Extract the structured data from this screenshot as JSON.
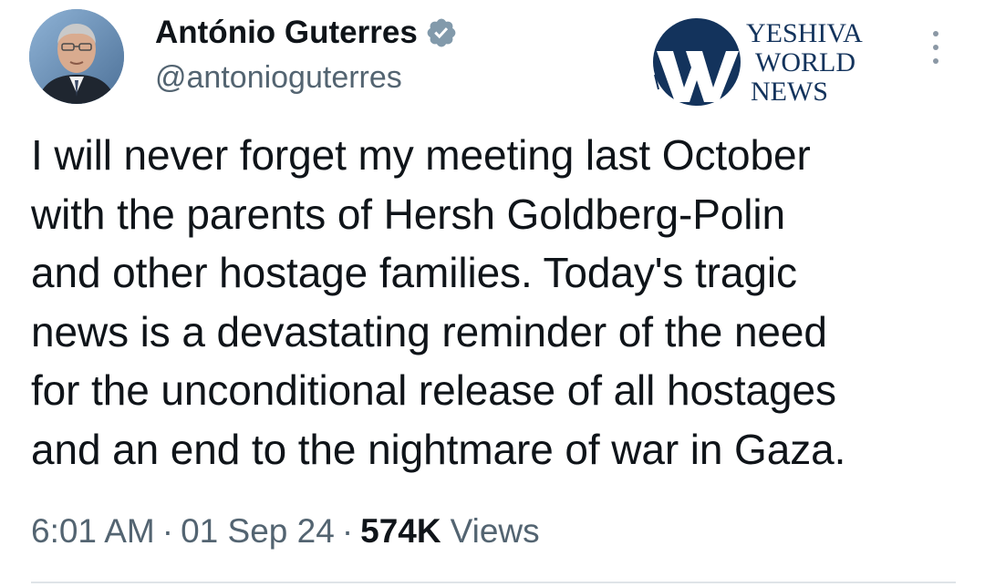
{
  "tweet": {
    "author": {
      "display_name": "António Guterres",
      "handle": "@antonioguterres",
      "verified": true,
      "avatar_icon": "profile-photo",
      "verified_icon": "verified-badge-icon"
    },
    "text": "I will never forget my meeting last October\nwith the parents of Hersh Goldberg-Polin\nand other hostage families. Today's tragic\nnews is a devastating reminder of the need\nfor the unconditional release of all hostages\nand an end to the nightmare of war in Gaza.",
    "meta": {
      "time": "6:01 AM",
      "separator": "·",
      "date": "01 Sep 24",
      "views_count": "574K",
      "views_label": "Views"
    },
    "more_icon": "more-vertical-icon"
  },
  "watermark": {
    "line1": "YESHIVA",
    "line2": "WORLD",
    "line3": "NEWS"
  },
  "colors": {
    "text_primary": "#0f1419",
    "text_secondary": "#536471",
    "verified_badge": "#829aab",
    "logo_navy": "#13335c",
    "divider": "#dfe4e8"
  }
}
